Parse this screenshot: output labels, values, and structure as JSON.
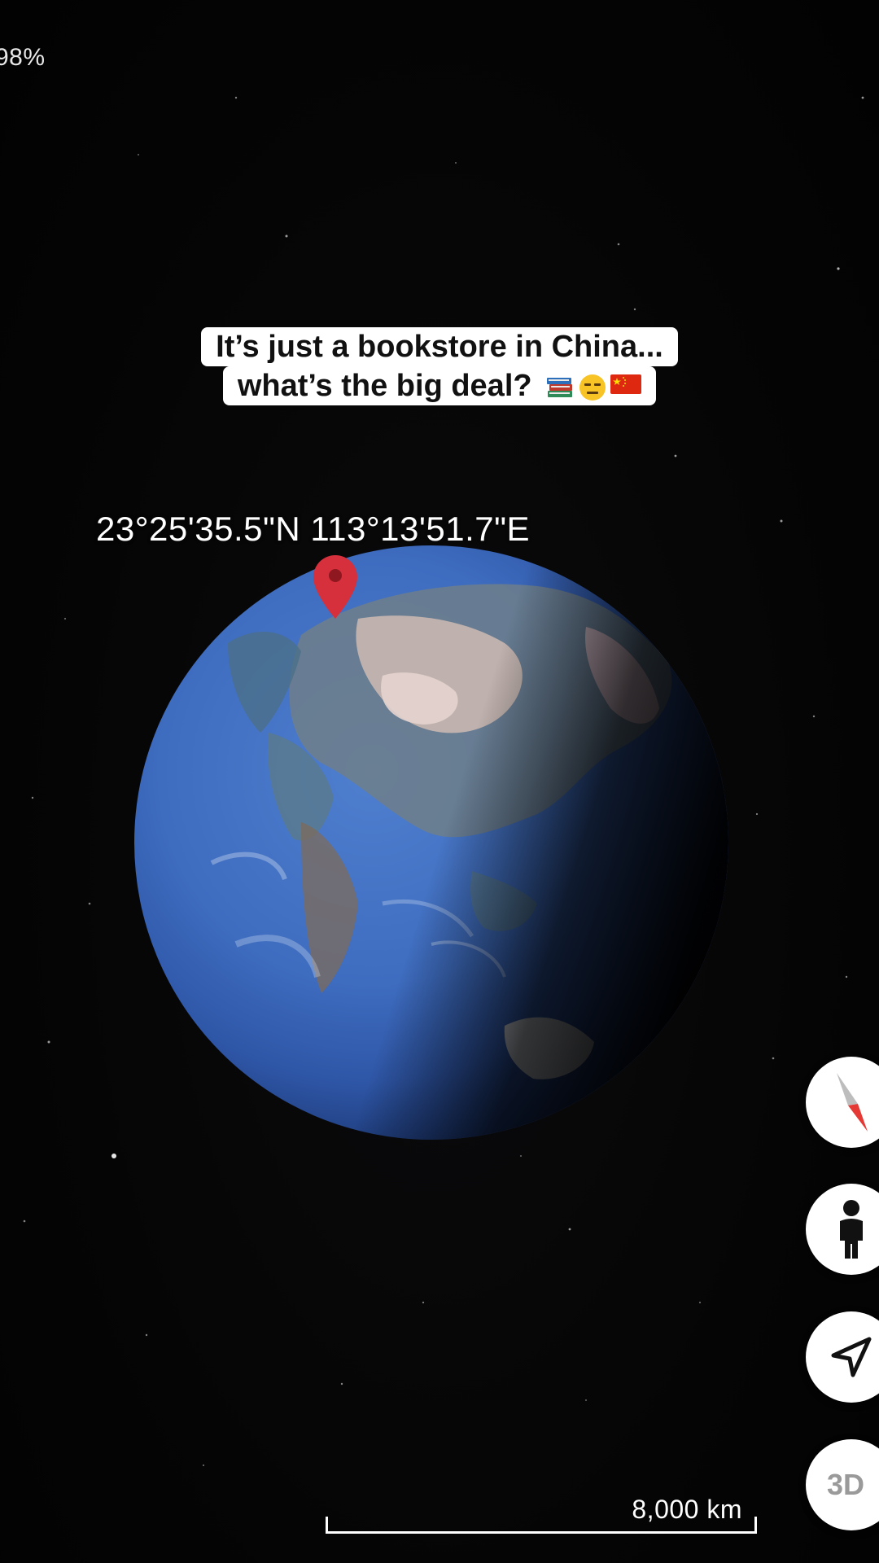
{
  "status": {
    "progress_text": "98%"
  },
  "caption": {
    "line1": "It’s just a bookstore in China...",
    "line2": "what’s the big deal?",
    "emojis": [
      "books-emoji",
      "expressionless-face-emoji",
      "china-flag-emoji"
    ]
  },
  "map": {
    "coordinates": "23°25'35.5\"N 113°13'51.7\"E",
    "marker_icon": "map-pin-icon",
    "marker_color": "#d6303c"
  },
  "controls": {
    "compass_icon": "compass-icon",
    "street_view_icon": "pegman-icon",
    "my_location_icon": "navigation-arrow-icon",
    "view_3d_label": "3D"
  },
  "scale": {
    "label": "8,000 km"
  },
  "colors": {
    "space": "#050505",
    "ocean": "#3f6fc2",
    "button_bg": "#ffffff"
  }
}
